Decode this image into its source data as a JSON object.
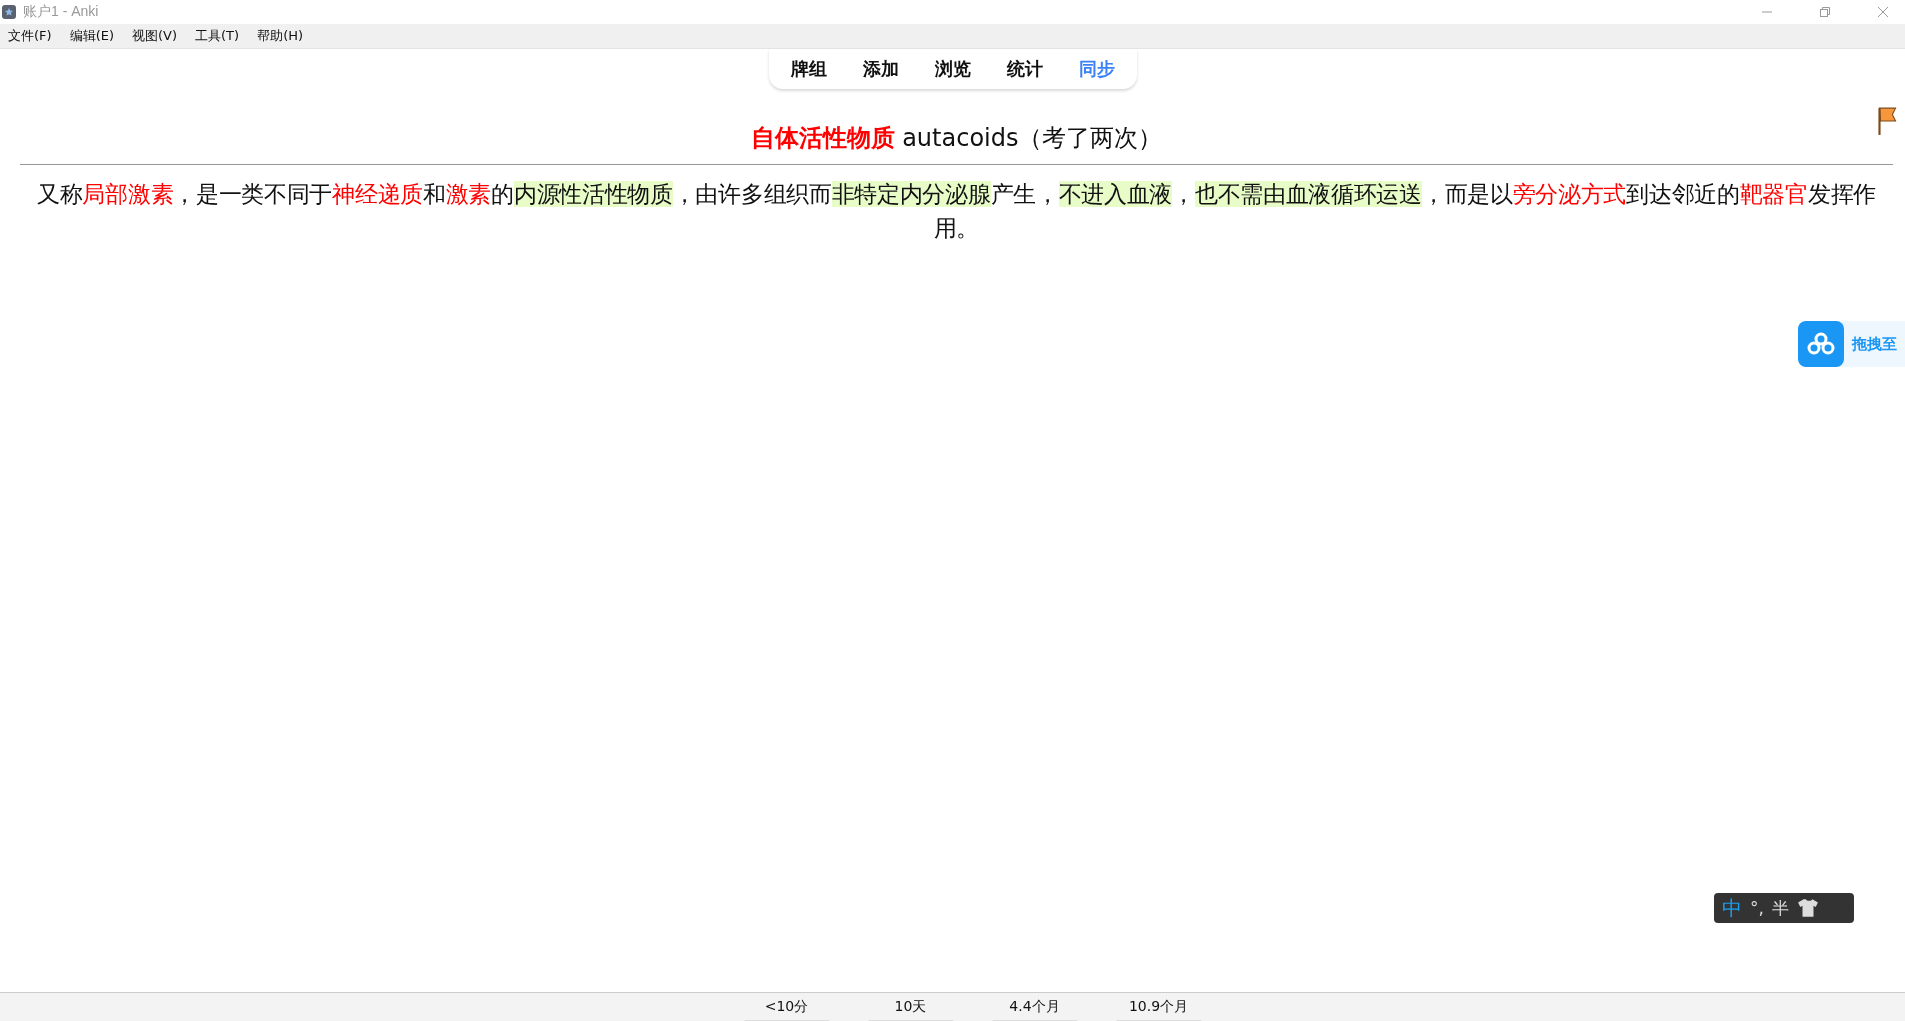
{
  "window": {
    "title": "账户1 - Anki"
  },
  "menu": [
    "文件(F)",
    "编辑(E)",
    "视图(V)",
    "工具(T)",
    "帮助(H)"
  ],
  "tabs": [
    {
      "label": "牌组",
      "selected": false
    },
    {
      "label": "添加",
      "selected": false
    },
    {
      "label": "浏览",
      "selected": false
    },
    {
      "label": "统计",
      "selected": false
    },
    {
      "label": "同步",
      "selected": true
    }
  ],
  "card": {
    "title": [
      {
        "kind": "term",
        "text": "自体活性物质"
      },
      {
        "kind": "plain",
        "text": " autacoids（考了两次）"
      }
    ],
    "body": [
      {
        "kind": "plain",
        "text": "又称"
      },
      {
        "kind": "red",
        "text": "局部激素"
      },
      {
        "kind": "plain",
        "text": "，是一类不同于"
      },
      {
        "kind": "red",
        "text": "神经递质"
      },
      {
        "kind": "plain",
        "text": "和"
      },
      {
        "kind": "red",
        "text": "激素"
      },
      {
        "kind": "plain",
        "text": "的"
      },
      {
        "kind": "highlight",
        "text": "内源性活性物质"
      },
      {
        "kind": "plain",
        "text": "，由许多组织而"
      },
      {
        "kind": "highlight",
        "text": "非特定内分泌腺"
      },
      {
        "kind": "plain",
        "text": "产生，"
      },
      {
        "kind": "highlight",
        "text": "不进入血液"
      },
      {
        "kind": "plain",
        "text": "，"
      },
      {
        "kind": "highlight",
        "text": "也不需由血液循环运送"
      },
      {
        "kind": "plain",
        "text": "，而是以"
      },
      {
        "kind": "red",
        "text": "旁分泌方式"
      },
      {
        "kind": "plain",
        "text": "到达邻近的"
      },
      {
        "kind": "red",
        "text": "靶器官"
      },
      {
        "kind": "plain",
        "text": "发挥作用。"
      }
    ]
  },
  "cloud_widget": {
    "label": "拖拽至"
  },
  "ime_bar": {
    "mode": "中",
    "punct": "°,",
    "width": "半"
  },
  "answer_times": [
    "<10分",
    "10天",
    "4.4个月",
    "10.9个月"
  ]
}
